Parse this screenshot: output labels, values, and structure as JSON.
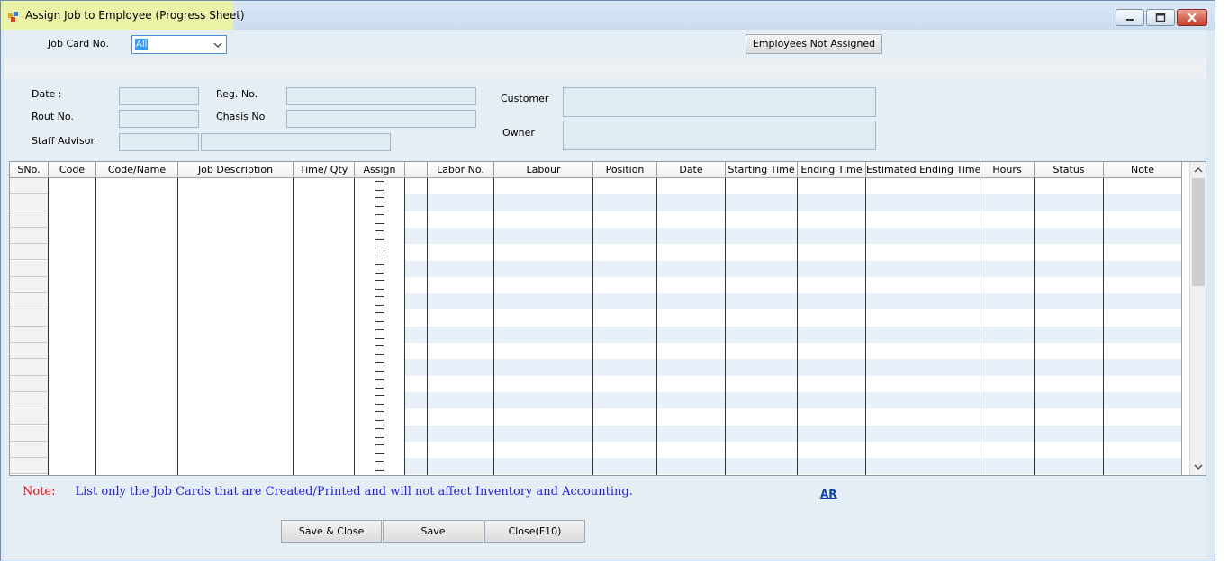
{
  "window": {
    "title": "Assign Job to Employee (Progress Sheet)"
  },
  "filter": {
    "job_card_label": "Job Card No.",
    "job_card_value": "All",
    "employees_not_assigned_label": "Employees Not Assigned"
  },
  "details": {
    "date_label": "Date :",
    "rout_label": "Rout No.",
    "staff_label": "Staff Advisor",
    "reg_label": "Reg. No.",
    "chasis_label": "Chasis No",
    "customer_label": "Customer",
    "owner_label": "Owner"
  },
  "grid": {
    "columns": [
      "SNo.",
      "Code",
      "Code/Name",
      "Job Description",
      "Time/ Qty",
      "Assign",
      "",
      "Labor No.",
      "Labour",
      "Position",
      "Date",
      "Starting Time",
      "Ending Time",
      "Estimated Ending Time",
      "Hours",
      "Status",
      "Note"
    ],
    "row_count": 18
  },
  "footer": {
    "note_label": "Note:",
    "note_text": "List only the Job Cards that are Created/Printed and will not affect Inventory and Accounting.",
    "ar_link": "AR",
    "save_close_label": "Save & Close",
    "save_label": "Save",
    "close_label": "Close(F10)"
  },
  "colors": {
    "accent": "#1a1aff",
    "note_red": "#ff0000",
    "title_highlight": "#e9f2a5"
  }
}
